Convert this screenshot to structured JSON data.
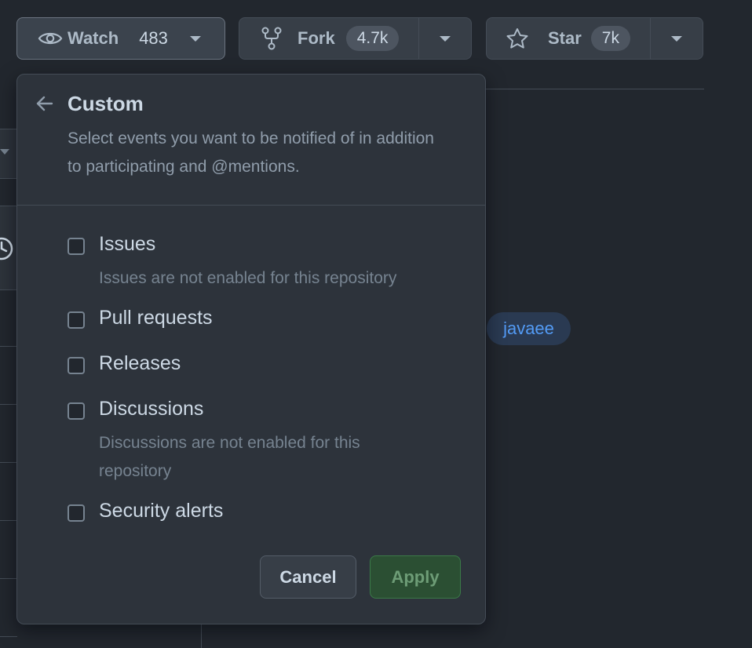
{
  "toolbar": {
    "watch": {
      "label": "Watch",
      "count": "483",
      "icon": "eye-icon"
    },
    "fork": {
      "label": "Fork",
      "count": "4.7k",
      "icon": "repo-forked-icon"
    },
    "star": {
      "label": "Star",
      "count": "7k",
      "icon": "star-icon"
    }
  },
  "background": {
    "topic": "javaee"
  },
  "panel": {
    "title": "Custom",
    "description": "Select events you want to be notified of in addition to participating and @mentions.",
    "options": [
      {
        "label": "Issues",
        "note": "Issues are not enabled for this repository",
        "checked": false
      },
      {
        "label": "Pull requests",
        "note": "",
        "checked": false
      },
      {
        "label": "Releases",
        "note": "",
        "checked": false
      },
      {
        "label": "Discussions",
        "note": "Discussions are not enabled for this repository",
        "checked": false
      },
      {
        "label": "Security alerts",
        "note": "",
        "checked": false
      }
    ],
    "cancel_label": "Cancel",
    "apply_label": "Apply"
  },
  "colors": {
    "background": "#22272e",
    "panel": "#2d333b",
    "border": "#444c56",
    "link": "#539bf5",
    "apply": "#2b4f33"
  }
}
